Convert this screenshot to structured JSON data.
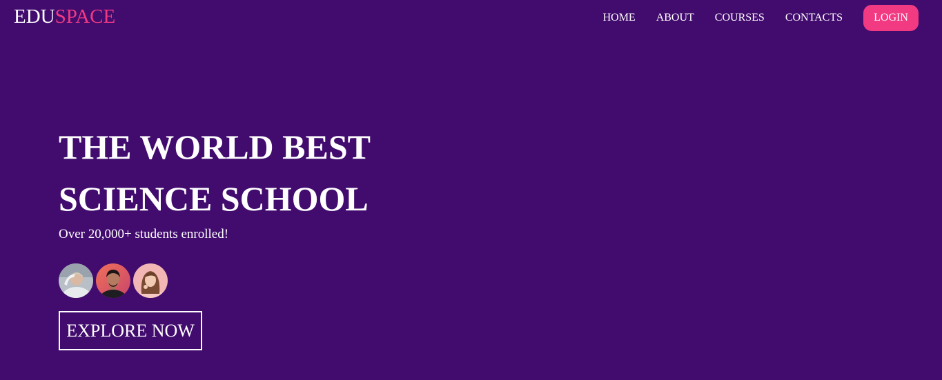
{
  "brand": {
    "part1": "EDU",
    "part2": "SPACE"
  },
  "nav": {
    "items": [
      {
        "label": "HOME"
      },
      {
        "label": "ABOUT"
      },
      {
        "label": "COURSES"
      },
      {
        "label": "CONTACTS"
      }
    ],
    "login_label": "LOGIN"
  },
  "hero": {
    "title_line1": "THE WORLD BEST",
    "title_line2": "SCIENCE SCHOOL",
    "subtitle": "Over 20,000+ students enrolled!",
    "cta_label": "EXPLORE NOW"
  },
  "colors": {
    "background": "#420c6e",
    "accent": "#f13a82",
    "text": "#ffffff"
  }
}
